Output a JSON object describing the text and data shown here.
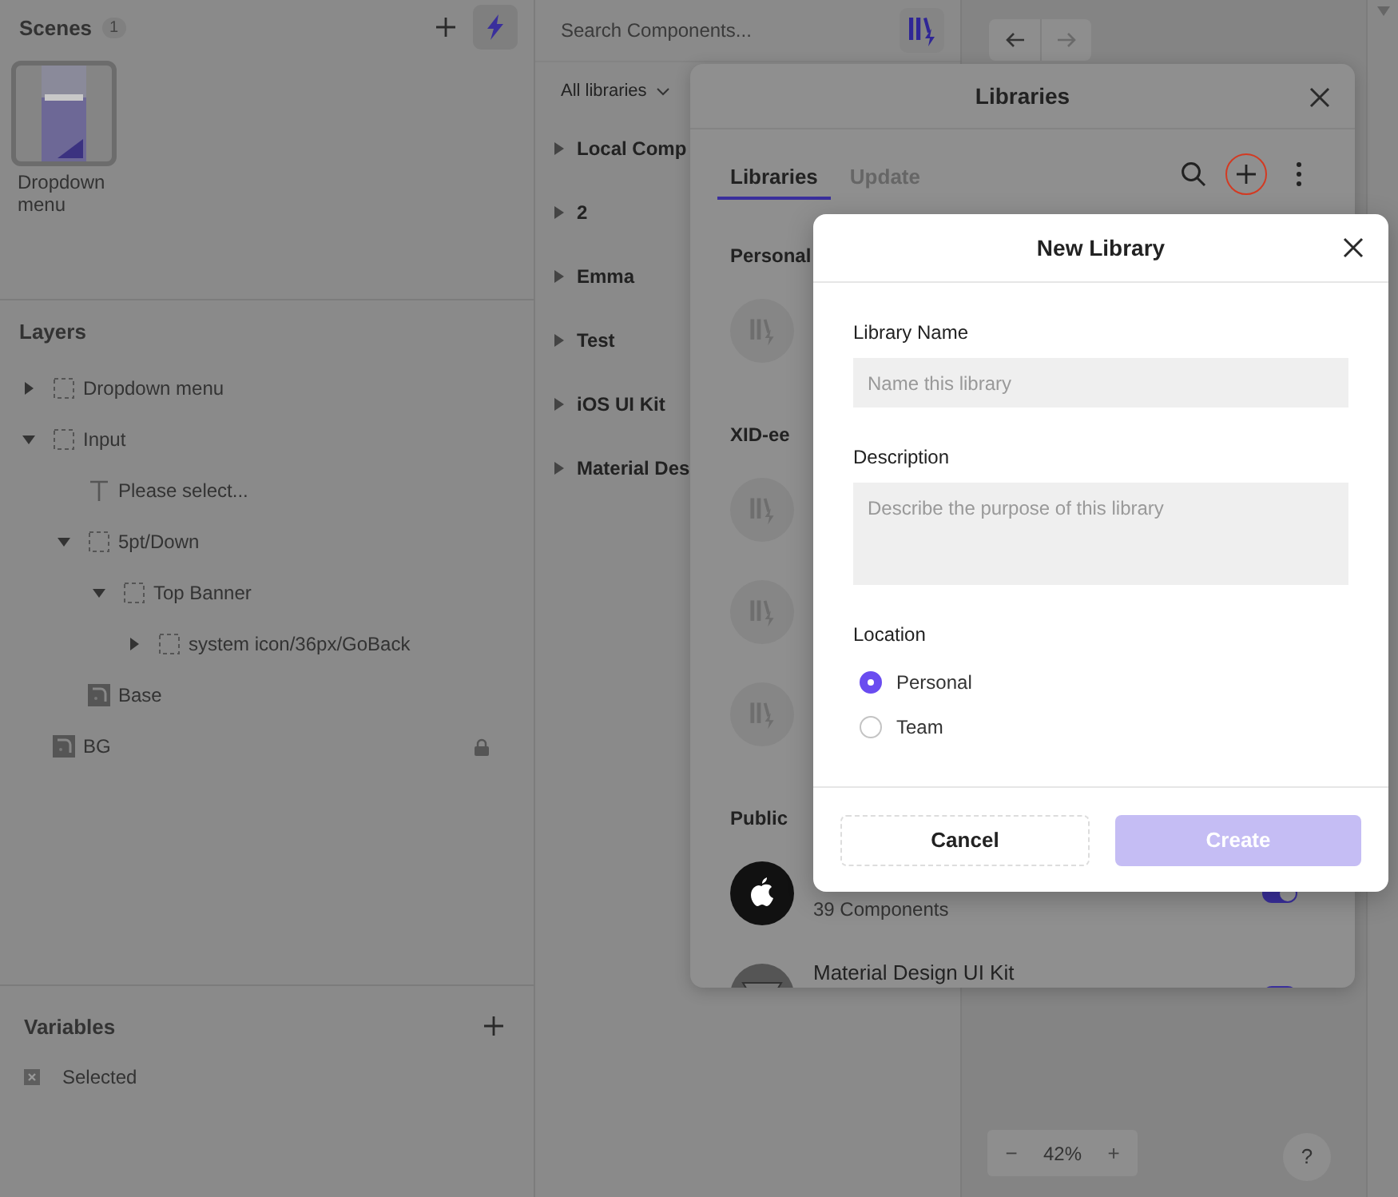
{
  "scenes": {
    "title": "Scenes",
    "count": "1",
    "items": [
      {
        "label": "Dropdown menu",
        "selected": true
      }
    ]
  },
  "layers": {
    "title": "Layers",
    "items": [
      {
        "kind": "group",
        "label": "Dropdown menu",
        "expanded": false
      },
      {
        "kind": "group",
        "label": "Input",
        "expanded": true,
        "children": [
          {
            "kind": "text",
            "label": "Please select..."
          },
          {
            "kind": "group",
            "label": "5pt/Down",
            "expanded": true,
            "children": [
              {
                "kind": "group",
                "label": "Top Banner",
                "expanded": true,
                "children": [
                  {
                    "kind": "group",
                    "label": "system icon/36px/GoBack",
                    "expanded": false
                  }
                ]
              }
            ]
          },
          {
            "kind": "image",
            "label": "Base"
          }
        ]
      },
      {
        "kind": "image",
        "label": "BG",
        "locked": true
      }
    ]
  },
  "variables": {
    "title": "Variables",
    "items": [
      {
        "label": "Selected"
      }
    ]
  },
  "components": {
    "search_placeholder": "Search Components...",
    "filter": "All libraries",
    "items": [
      {
        "label": "Local Comp",
        "expanded": false
      },
      {
        "label": "2",
        "expanded": false
      },
      {
        "label": "Emma",
        "expanded": false
      },
      {
        "label": "Test",
        "expanded": false
      },
      {
        "label": "iOS UI Kit",
        "expanded": false
      },
      {
        "label": "Material Des",
        "expanded": false
      }
    ]
  },
  "canvas": {
    "zoom_out": "−",
    "zoom": "42%",
    "zoom_in": "+",
    "help": "?"
  },
  "libraries_dialog": {
    "title": "Libraries",
    "tabs": [
      {
        "label": "Libraries",
        "selected": true
      },
      {
        "label": "Update",
        "selected": false
      }
    ],
    "add_highlighted": true,
    "sections": [
      {
        "title": "Personal",
        "libraries": [
          {
            "kind": "generic"
          }
        ]
      },
      {
        "title": "XID-ee",
        "libraries": [
          {
            "kind": "generic"
          },
          {
            "kind": "generic"
          },
          {
            "kind": "generic"
          }
        ]
      },
      {
        "title": "Public",
        "libraries": [
          {
            "kind": "apple",
            "subtitle": "39 Components",
            "on": true
          },
          {
            "kind": "material",
            "name": "Material Design UI Kit",
            "on": true
          }
        ]
      }
    ]
  },
  "new_library_dialog": {
    "title": "New Library",
    "fields": [
      {
        "kind": "input",
        "label": "Library Name",
        "placeholder": "Name this library"
      },
      {
        "kind": "textarea",
        "label": "Description",
        "placeholder": "Describe the purpose of this library"
      }
    ],
    "location": {
      "label": "Location",
      "options": [
        {
          "label": "Personal",
          "selected": true
        },
        {
          "label": "Team",
          "selected": false
        }
      ]
    },
    "buttons": [
      {
        "kind": "secondary",
        "label": "Cancel",
        "disabled": false
      },
      {
        "kind": "primary",
        "label": "Create",
        "disabled": true
      }
    ]
  }
}
